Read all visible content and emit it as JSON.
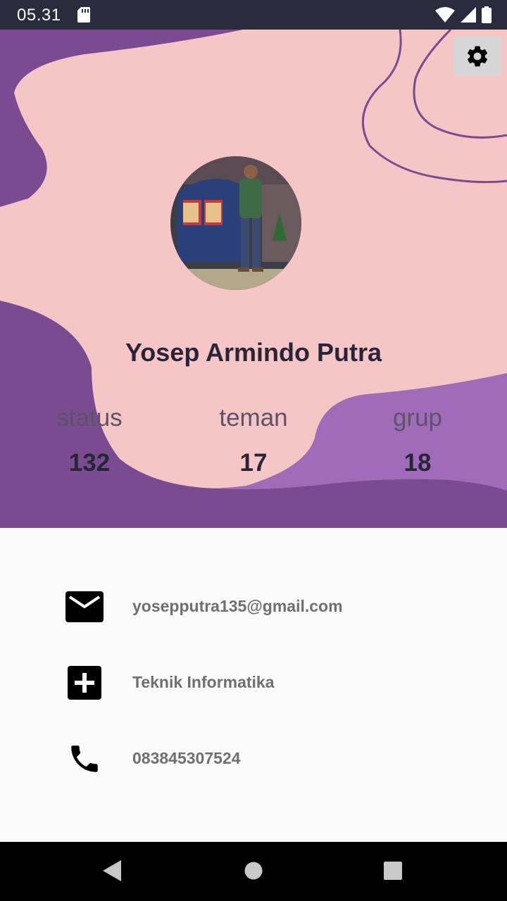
{
  "status_bar": {
    "time": "05.31"
  },
  "profile": {
    "name": "Yosep Armindo Putra",
    "avatar": "profile-photo"
  },
  "stats": [
    {
      "label": "status",
      "value": "132"
    },
    {
      "label": "teman",
      "value": "17"
    },
    {
      "label": "grup",
      "value": "18"
    }
  ],
  "info": {
    "email": "yosepputra135@gmail.com",
    "major": "Teknik Informatika",
    "phone": "083845307524"
  },
  "icons": {
    "settings": "gear-icon",
    "email": "mail-icon",
    "major": "plus-box-icon",
    "phone": "phone-icon"
  },
  "colors": {
    "header_pink": "#f6c6c6",
    "purple_dark": "#7b4b91",
    "purple_light": "#a06cba",
    "status_bar": "#2a2b3d"
  }
}
